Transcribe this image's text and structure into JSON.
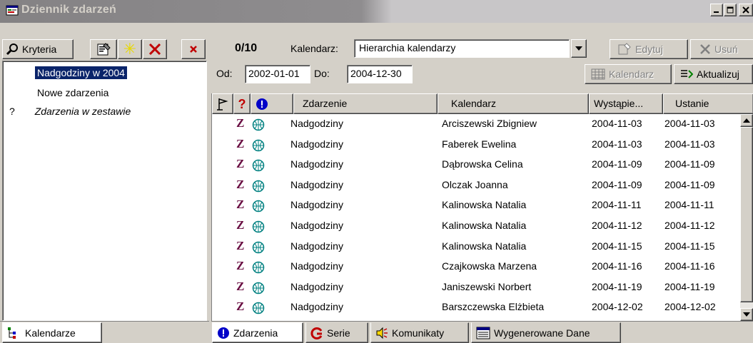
{
  "window": {
    "title": "Dziennik zdarzeń"
  },
  "left_toolbar": {
    "criteria_label": "Kryteria"
  },
  "left_tree": {
    "items": [
      {
        "label": "Nadgodziny w 2004",
        "prefix": ""
      },
      {
        "label": "Nowe zdarzenia",
        "prefix": ""
      },
      {
        "label": "Zdarzenia w zestawie",
        "prefix": "?"
      }
    ]
  },
  "left_tab": {
    "label": "Kalendarze"
  },
  "counter": "0/10",
  "calendar": {
    "label": "Kalendarz:",
    "value": "Hierarchia kalendarzy"
  },
  "toolbar": {
    "edit_label": "Edytuj",
    "delete_label": "Usuń",
    "calendar_btn_label": "Kalendarz",
    "refresh_label": "Aktualizuj"
  },
  "dates": {
    "from_label": "Od:",
    "from_value": "2002-01-01",
    "to_label": "Do:",
    "to_value": "2004-12-30"
  },
  "columns": {
    "event": "Zdarzenie",
    "calendar": "Kalendarz",
    "occurrence": "Wystąpie...",
    "set": "Ustanie"
  },
  "rows": [
    {
      "type": "Z",
      "event": "Nadgodziny",
      "calendar": "Arciszewski Zbigniew",
      "occurrence": "2004-11-03",
      "set": "2004-11-03"
    },
    {
      "type": "Z",
      "event": "Nadgodziny",
      "calendar": "Faberek Ewelina",
      "occurrence": "2004-11-03",
      "set": "2004-11-03"
    },
    {
      "type": "Z",
      "event": "Nadgodziny",
      "calendar": "Dąbrowska Celina",
      "occurrence": "2004-11-09",
      "set": "2004-11-09"
    },
    {
      "type": "Z",
      "event": "Nadgodziny",
      "calendar": "Olczak Joanna",
      "occurrence": "2004-11-09",
      "set": "2004-11-09"
    },
    {
      "type": "Z",
      "event": "Nadgodziny",
      "calendar": "Kalinowska Natalia",
      "occurrence": "2004-11-11",
      "set": "2004-11-11"
    },
    {
      "type": "Z",
      "event": "Nadgodziny",
      "calendar": "Kalinowska Natalia",
      "occurrence": "2004-11-12",
      "set": "2004-11-12"
    },
    {
      "type": "Z",
      "event": "Nadgodziny",
      "calendar": "Kalinowska Natalia",
      "occurrence": "2004-11-15",
      "set": "2004-11-15"
    },
    {
      "type": "Z",
      "event": "Nadgodziny",
      "calendar": "Czajkowska Marzena",
      "occurrence": "2004-11-16",
      "set": "2004-11-16"
    },
    {
      "type": "Z",
      "event": "Nadgodziny",
      "calendar": "Janiszewski Norbert",
      "occurrence": "2004-11-19",
      "set": "2004-11-19"
    },
    {
      "type": "Z",
      "event": "Nadgodziny",
      "calendar": "Barszczewska Elżbieta",
      "occurrence": "2004-12-02",
      "set": "2004-12-02"
    }
  ],
  "tabs": [
    {
      "label": "Zdarzenia"
    },
    {
      "label": "Serie"
    },
    {
      "label": "Komunikaty"
    },
    {
      "label": "Wygenerowane Dane"
    }
  ],
  "colors": {
    "selection": "#0a246a",
    "accent_red": "#c00000",
    "info_blue": "#0000c8",
    "glyph_purple": "#6a0f43"
  },
  "icons": [
    "app-icon",
    "search-icon",
    "properties-icon",
    "new-icon",
    "delete-icon",
    "close-icon",
    "flag-icon",
    "question-icon",
    "info-icon",
    "globe-icon",
    "calendar-icon",
    "refresh-icon",
    "scroll-up-icon",
    "scroll-down-icon",
    "series-icon",
    "speaker-icon",
    "data-icon",
    "tree-icon"
  ]
}
